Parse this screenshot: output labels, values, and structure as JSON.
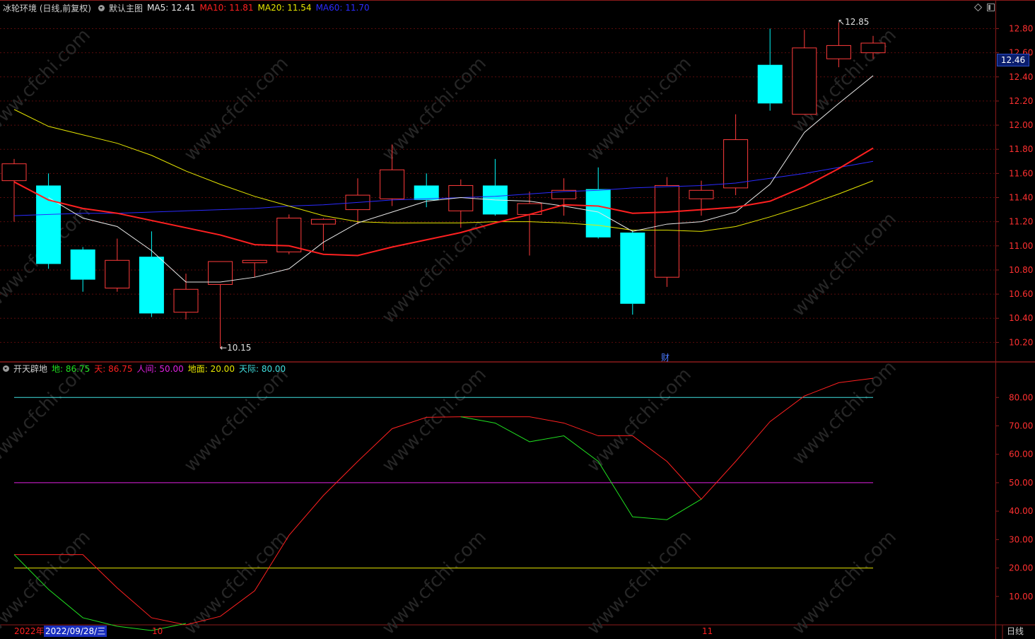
{
  "header": {
    "title": "冰轮环境 (日线,前复权)",
    "main_label": "默认主图",
    "ma5": {
      "label": "MA5:",
      "value": "12.41",
      "color": "#e8e8e8"
    },
    "ma10": {
      "label": "MA10:",
      "value": "11.81",
      "color": "#ff2020"
    },
    "ma20": {
      "label": "MA20:",
      "value": "11.54",
      "color": "#e6e600"
    },
    "ma60": {
      "label": "MA60:",
      "value": "11.70",
      "color": "#2b2bff"
    }
  },
  "sub_header": {
    "title": "开天辟地",
    "di": {
      "label": "地:",
      "value": "86.75",
      "color": "#20e020"
    },
    "tian": {
      "label": "天:",
      "value": "86.75",
      "color": "#ff2020"
    },
    "renjian": {
      "label": "人间:",
      "value": "50.00",
      "color": "#e020e0"
    },
    "dimian": {
      "label": "地面:",
      "value": "20.00",
      "color": "#e6e600"
    },
    "tianji": {
      "label": "天际:",
      "value": "80.00",
      "color": "#40e0e0"
    }
  },
  "current_price": "12.46",
  "date_bar": {
    "year": "2022年",
    "cursor_date": "2022/09/28/三",
    "month1": "10",
    "month2": "11",
    "period": "日线"
  },
  "annotations": {
    "high": "12.85",
    "low": "10.15",
    "finance": "财"
  },
  "watermark": "www.cfchi.com",
  "chart_data": [
    {
      "type": "candlestick",
      "ylim": [
        10.05,
        12.92
      ],
      "y_ticks": [
        "12.80",
        "12.60",
        "12.40",
        "12.20",
        "12.00",
        "11.80",
        "11.60",
        "11.40",
        "11.20",
        "11.00",
        "10.80",
        "10.60",
        "10.40",
        "10.20"
      ],
      "candles": [
        {
          "o": 11.54,
          "h": 11.72,
          "l": 11.2,
          "c": 11.68
        },
        {
          "o": 11.5,
          "h": 11.6,
          "l": 10.81,
          "c": 10.85
        },
        {
          "o": 10.97,
          "h": 10.99,
          "l": 10.62,
          "c": 10.72
        },
        {
          "o": 10.65,
          "h": 11.06,
          "l": 10.62,
          "c": 10.88
        },
        {
          "o": 10.91,
          "h": 11.12,
          "l": 10.41,
          "c": 10.44
        },
        {
          "o": 10.45,
          "h": 10.77,
          "l": 10.39,
          "c": 10.64
        },
        {
          "o": 10.68,
          "h": 10.86,
          "l": 10.15,
          "c": 10.87
        },
        {
          "o": 10.86,
          "h": 10.88,
          "l": 10.74,
          "c": 10.88
        },
        {
          "o": 10.95,
          "h": 11.26,
          "l": 10.93,
          "c": 11.23
        },
        {
          "o": 11.18,
          "h": 11.23,
          "l": 10.96,
          "c": 11.22
        },
        {
          "o": 11.3,
          "h": 11.56,
          "l": 11.18,
          "c": 11.42
        },
        {
          "o": 11.39,
          "h": 11.84,
          "l": 11.33,
          "c": 11.63
        },
        {
          "o": 11.5,
          "h": 11.6,
          "l": 11.32,
          "c": 11.38
        },
        {
          "o": 11.29,
          "h": 11.55,
          "l": 11.15,
          "c": 11.5
        },
        {
          "o": 11.5,
          "h": 11.72,
          "l": 11.25,
          "c": 11.26
        },
        {
          "o": 11.26,
          "h": 11.45,
          "l": 10.92,
          "c": 11.35
        },
        {
          "o": 11.39,
          "h": 11.56,
          "l": 11.25,
          "c": 11.46
        },
        {
          "o": 11.47,
          "h": 11.65,
          "l": 11.06,
          "c": 11.07
        },
        {
          "o": 11.11,
          "h": 11.13,
          "l": 10.43,
          "c": 10.52
        },
        {
          "o": 10.74,
          "h": 11.57,
          "l": 10.66,
          "c": 11.5
        },
        {
          "o": 11.39,
          "h": 11.54,
          "l": 11.25,
          "c": 11.46
        },
        {
          "o": 11.48,
          "h": 12.09,
          "l": 11.42,
          "c": 11.88
        },
        {
          "o": 12.5,
          "h": 12.8,
          "l": 12.12,
          "c": 12.18
        },
        {
          "o": 12.09,
          "h": 12.79,
          "l": 12.09,
          "c": 12.64
        },
        {
          "o": 12.55,
          "h": 12.85,
          "l": 12.48,
          "c": 12.66
        },
        {
          "o": 12.6,
          "h": 12.74,
          "l": 12.55,
          "c": 12.68
        }
      ],
      "ma5": [
        null,
        11.4,
        11.23,
        11.16,
        10.96,
        10.7,
        10.7,
        10.74,
        10.81,
        11.03,
        11.19,
        11.28,
        11.37,
        11.4,
        11.38,
        11.37,
        11.33,
        11.28,
        11.12,
        11.18,
        11.2,
        11.28,
        11.51,
        11.94,
        12.18,
        12.41
      ],
      "ma10": [
        11.53,
        11.38,
        11.31,
        11.27,
        11.21,
        11.15,
        11.09,
        11.01,
        11.0,
        10.93,
        10.92,
        10.99,
        11.05,
        11.11,
        11.19,
        11.26,
        11.34,
        11.33,
        11.27,
        11.28,
        11.3,
        11.32,
        11.37,
        11.49,
        11.64,
        11.81
      ],
      "ma20": [
        12.13,
        11.99,
        11.92,
        11.85,
        11.75,
        11.62,
        11.51,
        11.41,
        11.33,
        11.25,
        11.2,
        11.19,
        11.19,
        11.19,
        11.2,
        11.2,
        11.19,
        11.17,
        11.13,
        11.13,
        11.12,
        11.16,
        11.24,
        11.33,
        11.43,
        11.54
      ],
      "ma60": [
        11.25,
        11.26,
        11.27,
        11.27,
        11.28,
        11.29,
        11.3,
        11.31,
        11.33,
        11.34,
        11.36,
        11.38,
        11.39,
        11.4,
        11.41,
        11.43,
        11.45,
        11.46,
        11.48,
        11.49,
        11.5,
        11.52,
        11.56,
        11.6,
        11.65,
        11.7
      ]
    },
    {
      "type": "line",
      "title": "开天辟地",
      "ylim": [
        0,
        92
      ],
      "y_ticks": [
        "80.00",
        "70.00",
        "60.00",
        "50.00",
        "40.00",
        "30.00",
        "20.00",
        "10.00"
      ],
      "series": [
        {
          "name": "地",
          "values": [
            24.7,
            12.5,
            2.5,
            -0.5,
            -2,
            0.5,
            null,
            null,
            null,
            null,
            null,
            null,
            null,
            73.2,
            71.0,
            64.4,
            66.5,
            57.5,
            38.0,
            37.0,
            44.2,
            null,
            null,
            null,
            null,
            null
          ]
        },
        {
          "name": "天",
          "values": [
            24.7,
            24.7,
            24.7,
            13.0,
            2.5,
            0,
            3.0,
            12.0,
            31.5,
            45.5,
            57.5,
            69.0,
            73.0,
            73.2,
            73.2,
            73.2,
            71.0,
            66.5,
            66.5,
            57.5,
            44.2,
            57.5,
            71.5,
            80.5,
            85.2,
            86.75
          ]
        },
        {
          "name": "人间",
          "values": [
            50
          ]
        },
        {
          "name": "地面",
          "values": [
            20
          ]
        },
        {
          "name": "天际",
          "values": [
            80
          ]
        }
      ]
    }
  ]
}
